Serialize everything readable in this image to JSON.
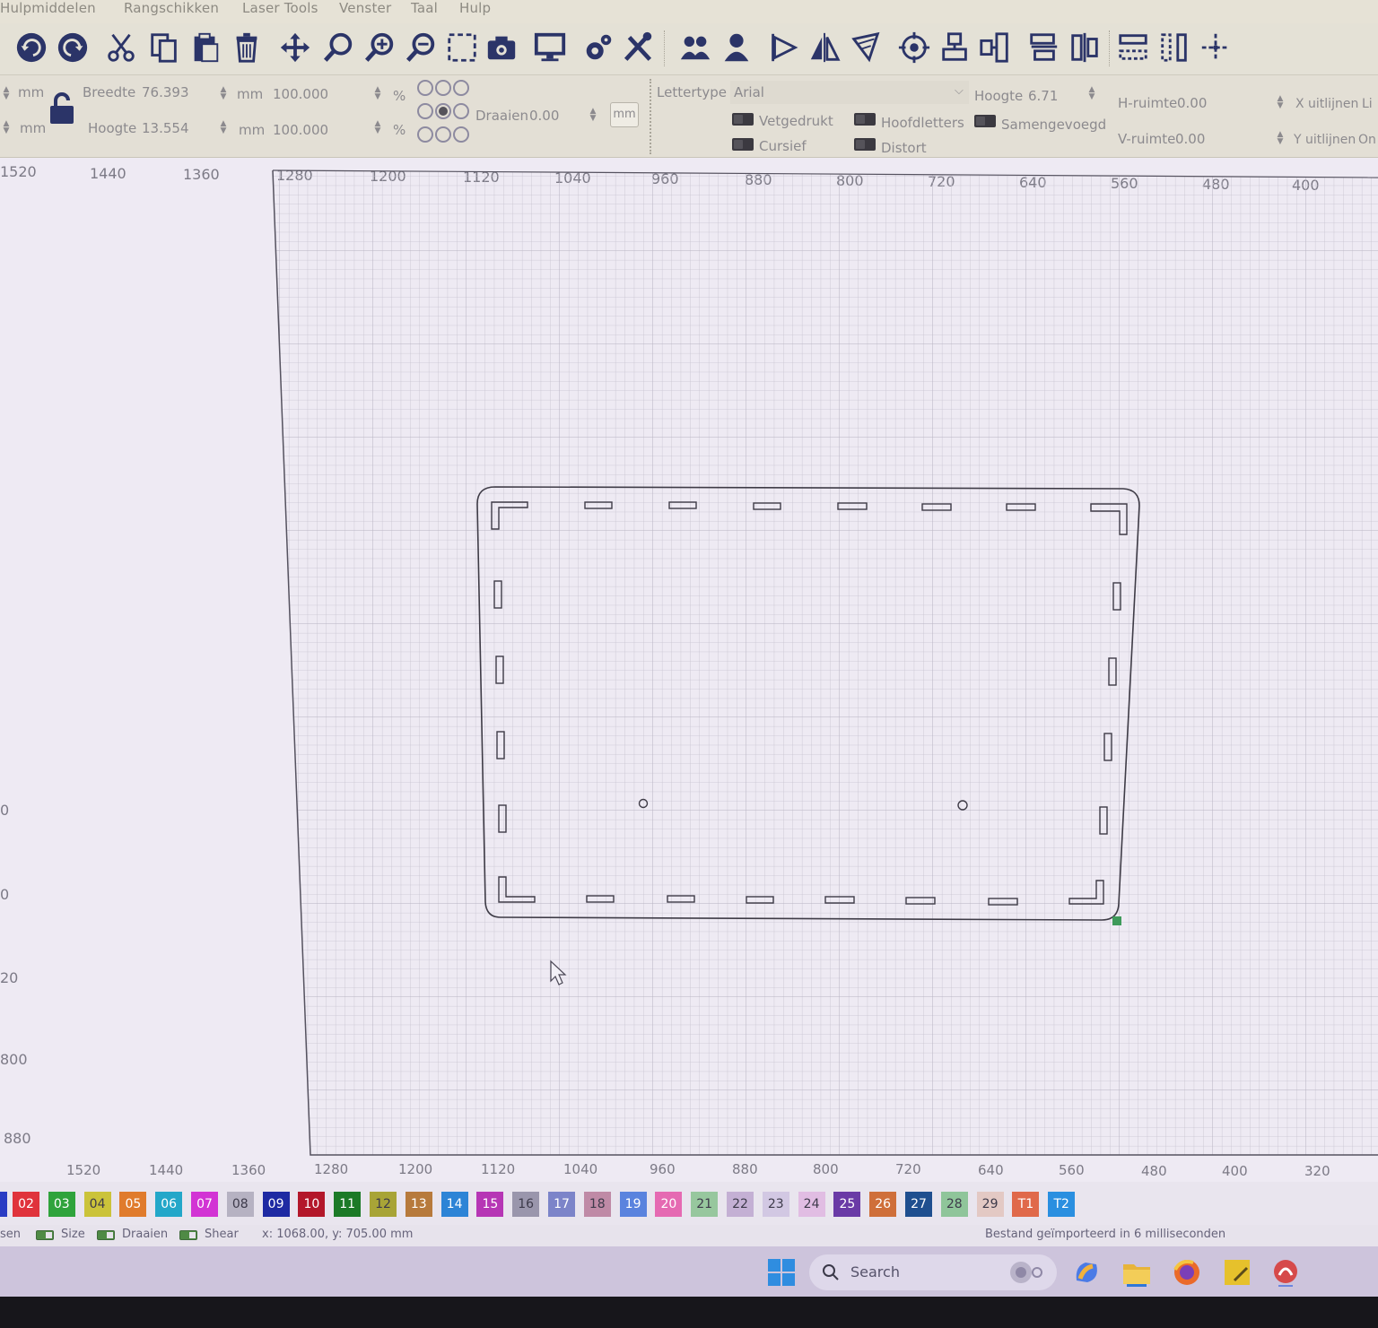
{
  "menu": [
    "Hulpmiddelen",
    "Rangschikken",
    "Laser Tools",
    "Venster",
    "Taal",
    "Hulp"
  ],
  "toolbar": {
    "icons": [
      "undo-icon",
      "redo-icon",
      "cut-icon",
      "copy-icon",
      "paste-icon",
      "delete-icon",
      "move-icon",
      "zoom-icon",
      "zoom-in-icon",
      "zoom-out-icon",
      "select-frame-icon",
      "camera-icon",
      "monitor-icon",
      "settings-icon",
      "tools-icon",
      "group-icon",
      "ungroup-icon",
      "align-icon",
      "mirror-icon",
      "transform-icon",
      "target-icon",
      "align-center-icon",
      "distribute-icon",
      "align-vertical-icon",
      "align-middle-icon",
      "align-horizontal-icon",
      "distribute-vertical-icon",
      "origin-icon"
    ]
  },
  "props": {
    "unit_mm_1": "mm",
    "unit_mm_2": "mm",
    "width_label": "Breedte",
    "width_value": "76.393",
    "height_label": "Hoogte",
    "height_value": "13.554",
    "scale_unit_1": "mm",
    "scale_value_1": "100.000",
    "scale_unit_2": "mm",
    "scale_value_2": "100.000",
    "pct_1": "%",
    "pct_2": "%",
    "rotate_label": "Draaien",
    "rotate_value": "0.00",
    "unit_button": "mm",
    "font_label": "Lettertype",
    "font_value": "Arial",
    "text_height_label": "Hoogte",
    "text_height_value": "6.71",
    "bold": "Vetgedrukt",
    "uppercase": "Hoofdletters",
    "welded": "Samengevoegd",
    "italic": "Cursief",
    "distort": "Distort",
    "h_space_label": "H-ruimte",
    "h_space_value": "0.00",
    "v_space_label": "V-ruimte",
    "v_space_value": "0.00",
    "x_align": "X uitlijnen",
    "x_align_value": "Li",
    "y_align": "Y uitlijnen",
    "y_align_value": "On"
  },
  "ruler_top": [
    "1520",
    "1440",
    "1360",
    "1280",
    "1200",
    "1120",
    "1040",
    "960",
    "880",
    "800",
    "720",
    "640",
    "560",
    "480",
    "400"
  ],
  "ruler_left": [
    "0",
    "0",
    "20",
    "800",
    "880"
  ],
  "ruler_bottom": [
    "1520",
    "1440",
    "1360",
    "1280",
    "1200",
    "1120",
    "1040",
    "960",
    "880",
    "800",
    "720",
    "640",
    "560",
    "480",
    "400",
    "320"
  ],
  "palette": [
    {
      "label": "02",
      "color": "#e0333c"
    },
    {
      "label": "03",
      "color": "#2fa33c"
    },
    {
      "label": "04",
      "color": "#cbc33a"
    },
    {
      "label": "05",
      "color": "#e07b2c"
    },
    {
      "label": "06",
      "color": "#23a7c9"
    },
    {
      "label": "07",
      "color": "#d234d4"
    },
    {
      "label": "08",
      "color": "#b6b2c2"
    },
    {
      "label": "09",
      "color": "#1e2aa3"
    },
    {
      "label": "10",
      "color": "#b3172a"
    },
    {
      "label": "11",
      "color": "#1c7a27"
    },
    {
      "label": "12",
      "color": "#a8a437"
    },
    {
      "label": "13",
      "color": "#b77a3c"
    },
    {
      "label": "14",
      "color": "#2d84d6"
    },
    {
      "label": "15",
      "color": "#b636b5"
    },
    {
      "label": "16",
      "color": "#9a96ac"
    },
    {
      "label": "17",
      "color": "#7c84c9"
    },
    {
      "label": "18",
      "color": "#bf8aa6"
    },
    {
      "label": "19",
      "color": "#5a83de"
    },
    {
      "label": "20",
      "color": "#e56ab2"
    },
    {
      "label": "21",
      "color": "#97c79e"
    },
    {
      "label": "22",
      "color": "#c4b0d4"
    },
    {
      "label": "23",
      "color": "#d2c8e3"
    },
    {
      "label": "24",
      "color": "#e1bde3"
    },
    {
      "label": "25",
      "color": "#6a3aa6"
    },
    {
      "label": "26",
      "color": "#cf6f3a"
    },
    {
      "label": "27",
      "color": "#1f4f8f"
    },
    {
      "label": "28",
      "color": "#8fc59a"
    },
    {
      "label": "29",
      "color": "#e3c9c4"
    },
    {
      "label": "T1",
      "color": "#e0694a"
    },
    {
      "label": "T2",
      "color": "#2a8fe0"
    }
  ],
  "status": {
    "left_cut": "sen",
    "size": "Size",
    "rotate": "Draaien",
    "shear": "Shear",
    "coords": "x: 1068.00, y: 705.00 mm",
    "message": "Bestand geïmporteerd in 6 milliseconden"
  },
  "taskbar": {
    "search_placeholder": "Search"
  },
  "colors": {
    "menu_bg": "#e6e2d6",
    "toolbar_icon": "#2b3468",
    "canvas_grid": "#c8c4cf",
    "selection_handle": "#3e9a5a"
  }
}
